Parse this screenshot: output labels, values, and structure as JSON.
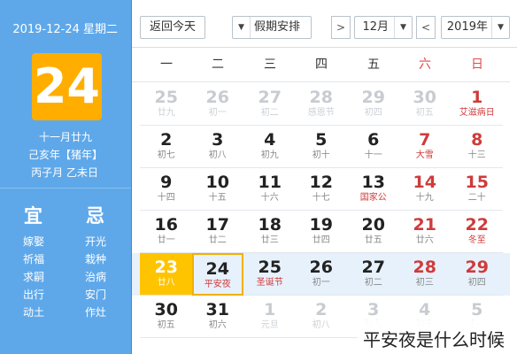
{
  "side": {
    "date": "2019-12-24 星期二",
    "day": "24",
    "lunar": [
      "十一月廿九",
      "己亥年【猪年】",
      "丙子月 乙未日"
    ],
    "yi_title": "宜",
    "ji_title": "忌",
    "yi_items": [
      "嫁娶",
      "祈福",
      "求嗣",
      "出行",
      "动土"
    ],
    "ji_items": [
      "开光",
      "栽种",
      "治病",
      "安门",
      "作灶"
    ]
  },
  "toolbar": {
    "year": "2019年",
    "prev": "<",
    "month": "12月",
    "next": ">",
    "holiday": "假期安排",
    "today_btn": "返回今天",
    "dropdown": "▼"
  },
  "weekdays": [
    "一",
    "二",
    "三",
    "四",
    "五",
    "六",
    "日"
  ],
  "weeks": [
    [
      [
        "25",
        "廿九",
        "out"
      ],
      [
        "26",
        "初一",
        "out"
      ],
      [
        "27",
        "初二",
        "out"
      ],
      [
        "28",
        "感恩节",
        "out"
      ],
      [
        "29",
        "初四",
        "out"
      ],
      [
        "30",
        "初五",
        "out"
      ],
      [
        "1",
        "艾滋病日",
        "fest we"
      ]
    ],
    [
      [
        "2",
        "初七",
        ""
      ],
      [
        "3",
        "初八",
        ""
      ],
      [
        "4",
        "初九",
        ""
      ],
      [
        "5",
        "初十",
        ""
      ],
      [
        "6",
        "十一",
        ""
      ],
      [
        "7",
        "大雪",
        "fest we"
      ],
      [
        "8",
        "十三",
        "we"
      ]
    ],
    [
      [
        "9",
        "十四",
        ""
      ],
      [
        "10",
        "十五",
        ""
      ],
      [
        "11",
        "十六",
        ""
      ],
      [
        "12",
        "十七",
        ""
      ],
      [
        "13",
        "国家公",
        "fest"
      ],
      [
        "14",
        "十九",
        "we"
      ],
      [
        "15",
        "二十",
        "we"
      ]
    ],
    [
      [
        "16",
        "廿一",
        ""
      ],
      [
        "17",
        "廿二",
        ""
      ],
      [
        "18",
        "廿三",
        ""
      ],
      [
        "19",
        "廿四",
        ""
      ],
      [
        "20",
        "廿五",
        ""
      ],
      [
        "21",
        "廿六",
        "we"
      ],
      [
        "22",
        "冬至",
        "fest we"
      ]
    ],
    [
      [
        "23",
        "廿八",
        "today"
      ],
      [
        "24",
        "平安夜",
        "sel fest"
      ],
      [
        "25",
        "圣诞节",
        "fest"
      ],
      [
        "26",
        "初一",
        ""
      ],
      [
        "27",
        "初二",
        ""
      ],
      [
        "28",
        "初三",
        "we"
      ],
      [
        "29",
        "初四",
        "we"
      ]
    ],
    [
      [
        "30",
        "初五",
        ""
      ],
      [
        "31",
        "初六",
        ""
      ],
      [
        "1",
        "元旦",
        "out"
      ],
      [
        "2",
        "初八",
        "out"
      ],
      [
        "3",
        "初九",
        "out"
      ],
      [
        "4",
        "初十",
        "out"
      ],
      [
        "5",
        "十一",
        "out"
      ]
    ]
  ],
  "caption": "平安夜是什么时候"
}
